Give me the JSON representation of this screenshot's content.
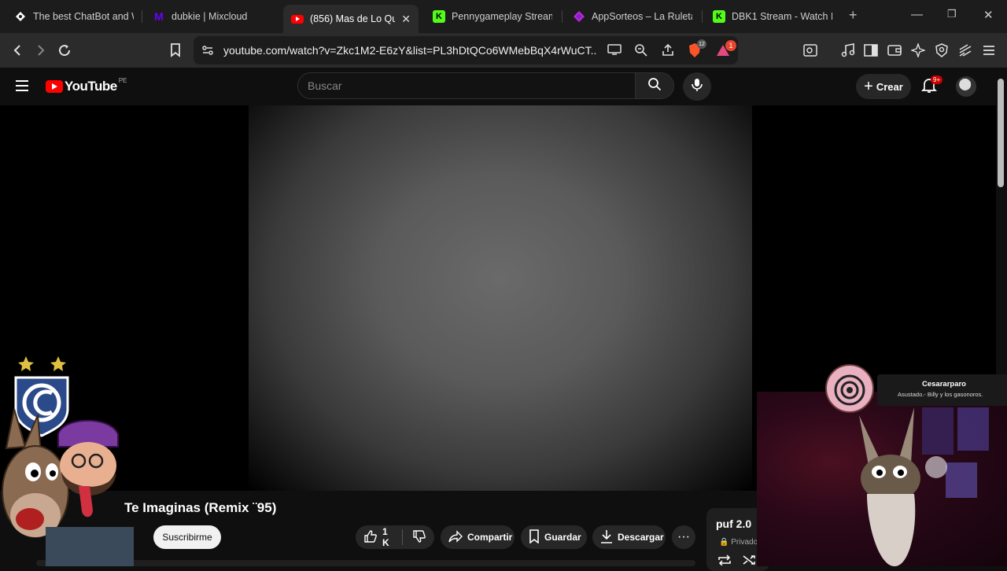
{
  "browser": {
    "tabs": [
      {
        "title": "The best ChatBot and W",
        "icon": "diamond-icon",
        "active": false
      },
      {
        "title": "dubkie | Mixcloud",
        "icon": "mixcloud-icon",
        "active": false
      },
      {
        "title": "(856) Mas de Lo Qu",
        "icon": "youtube-icon",
        "active": true
      },
      {
        "title": "Pennygameplay Stream",
        "icon": "kick-icon",
        "active": false
      },
      {
        "title": "AppSorteos – La Ruleta",
        "icon": "appsorteos-icon",
        "active": false
      },
      {
        "title": "DBK1 Stream - Watch Li",
        "icon": "kick-icon",
        "active": false
      }
    ],
    "new_tab": "+",
    "url": "youtube.com/watch?v=Zkc1M2-E6zY&list=PL3hDtQCo6WMebBqX4rWuCT...",
    "extension_badge": "1",
    "shield_badge": "12"
  },
  "youtube": {
    "logo_text": "YouTube",
    "country_code": "PE",
    "search_placeholder": "Buscar",
    "create_label": "Crear",
    "notifications_badge": "9+"
  },
  "video": {
    "title": "Te Imaginas (Remix ¨95)",
    "subscribe_label": "Suscribirme",
    "likes": "1 K",
    "share_label": "Compartir",
    "save_label": "Guardar",
    "download_label": "Descargar",
    "more_label": "···"
  },
  "playlist": {
    "title": "puf 2.0",
    "privacy": "Privado"
  },
  "stream_overlay": {
    "alert_name": "Cesararparo",
    "alert_song": "Asustado.- Billy y los gasonoros."
  },
  "colors": {
    "youtube_red": "#ff0000",
    "browser_bg": "#2b2b2b",
    "page_bg": "#0f0f0f",
    "kick_green": "#53fc18",
    "mixcloud_purple": "#5000ff"
  }
}
